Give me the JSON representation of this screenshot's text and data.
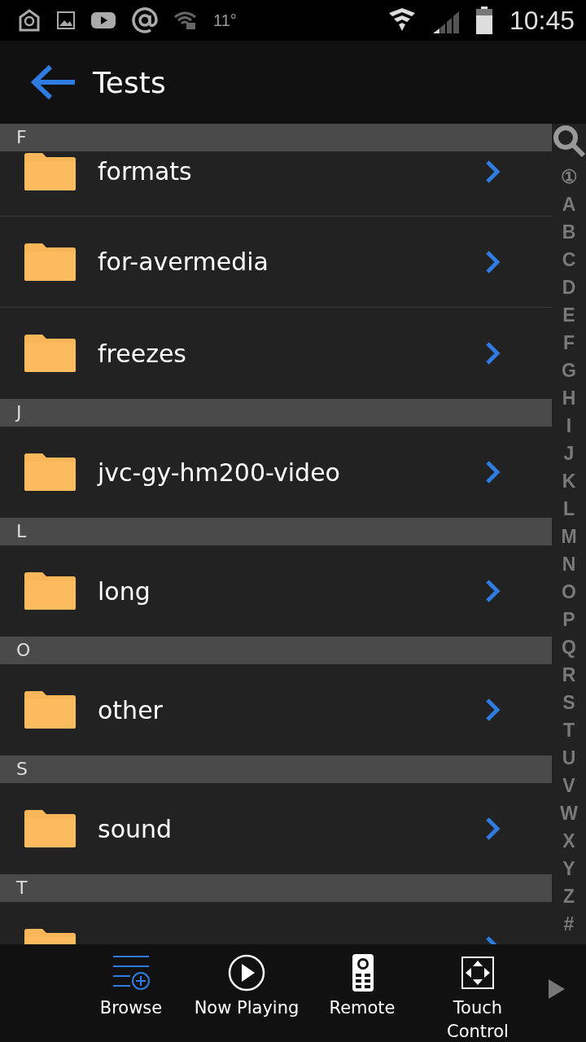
{
  "status_bar": {
    "temperature": "11°",
    "time": "10:45"
  },
  "header": {
    "title": "Tests"
  },
  "sections": [
    {
      "letter": "F",
      "items": [
        {
          "kind": "folder",
          "name": "formats"
        },
        {
          "kind": "folder",
          "name": "for-avermedia"
        },
        {
          "kind": "folder",
          "name": "freezes"
        }
      ]
    },
    {
      "letter": "J",
      "items": [
        {
          "kind": "folder",
          "name": "jvc-gy-hm200-video"
        }
      ]
    },
    {
      "letter": "L",
      "items": [
        {
          "kind": "folder",
          "name": "long"
        }
      ]
    },
    {
      "letter": "O",
      "items": [
        {
          "kind": "folder",
          "name": "other"
        }
      ]
    },
    {
      "letter": "S",
      "items": [
        {
          "kind": "folder",
          "name": "sound"
        }
      ]
    },
    {
      "letter": "T",
      "items": [
        {
          "kind": "folder"
        }
      ]
    }
  ],
  "index": [
    "①",
    "A",
    "B",
    "C",
    "D",
    "E",
    "F",
    "G",
    "H",
    "I",
    "J",
    "K",
    "L",
    "M",
    "N",
    "O",
    "P",
    "Q",
    "R",
    "S",
    "T",
    "U",
    "V",
    "W",
    "X",
    "Y",
    "Z",
    "#"
  ],
  "nav": [
    {
      "kind": "browse",
      "label": "Browse",
      "selected": true
    },
    {
      "kind": "play",
      "label": "Now Playing",
      "selected": false
    },
    {
      "kind": "remote",
      "label": "Remote",
      "selected": false
    },
    {
      "kind": "touch",
      "label": "Touch Control",
      "selected": false
    }
  ]
}
